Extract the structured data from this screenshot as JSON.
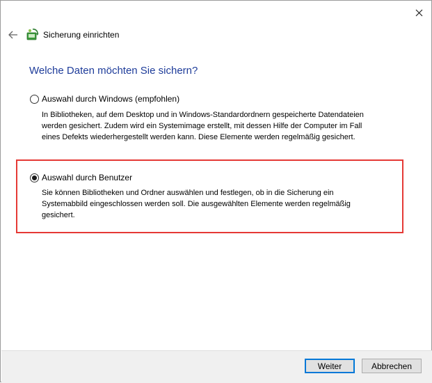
{
  "window": {
    "title": "Sicherung einrichten",
    "close_icon": "close-icon",
    "back_icon": "back-arrow-icon",
    "app_icon": "backup-icon"
  },
  "main": {
    "heading": "Welche Daten möchten Sie sichern?",
    "options": [
      {
        "label": "Auswahl durch Windows (empfohlen)",
        "selected": false,
        "description": [
          "In Bibliotheken, auf dem Desktop und in Windows-Standardordnern gespeicherte Datendateien",
          "werden gesichert. Zudem wird ein Systemimage erstellt, mit dessen Hilfe der Computer im Fall",
          "eines Defekts wiederhergestellt werden kann. Diese Elemente werden regelmäßig gesichert."
        ]
      },
      {
        "label": "Auswahl durch Benutzer",
        "selected": true,
        "description": [
          "Sie können Bibliotheken und Ordner auswählen und festlegen, ob in die Sicherung ein",
          "Systemabbild eingeschlossen werden soll. Die ausgewählten Elemente werden regelmäßig",
          "gesichert."
        ]
      }
    ],
    "highlight_color": "#e53935",
    "heading_color": "#1e3c9a"
  },
  "footer": {
    "next_label": "Weiter",
    "cancel_label": "Abbrechen"
  }
}
